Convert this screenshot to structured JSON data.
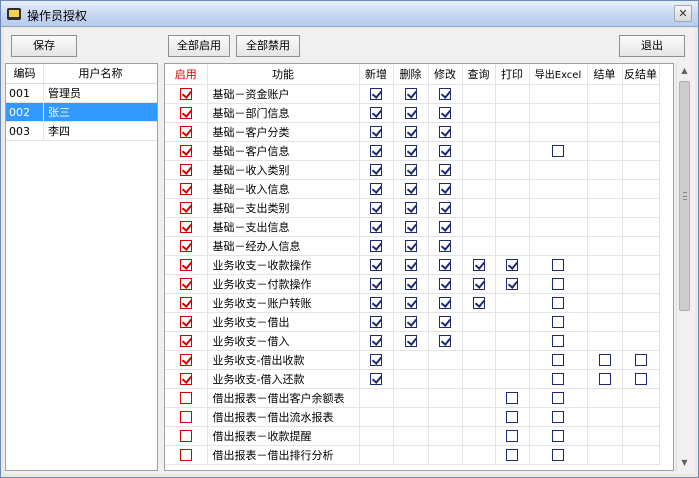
{
  "window": {
    "title": "操作员授权",
    "close_label": "✕"
  },
  "toolbar": {
    "save_label": "保存",
    "enable_all_label": "全部启用",
    "disable_all_label": "全部禁用",
    "exit_label": "退出"
  },
  "users": {
    "headers": {
      "code": "编码",
      "name": "用户名称"
    },
    "rows": [
      {
        "code": "001",
        "name": "管理员",
        "selected": false
      },
      {
        "code": "002",
        "name": "张三",
        "selected": true
      },
      {
        "code": "003",
        "name": "李四",
        "selected": false
      }
    ]
  },
  "permissions": {
    "headers": {
      "enabled": "启用",
      "function": "功能",
      "add": "新增",
      "delete": "删除",
      "edit": "修改",
      "query": "查询",
      "print": "打印",
      "export": "导出Excel",
      "close": "结单",
      "reopen": "反结单"
    },
    "rows": [
      {
        "enabled": true,
        "function": "基础－资金账户",
        "add": true,
        "delete": true,
        "edit": true,
        "query": null,
        "print": null,
        "export": null,
        "close": null,
        "reopen": null
      },
      {
        "enabled": true,
        "function": "基础－部门信息",
        "add": true,
        "delete": true,
        "edit": true,
        "query": null,
        "print": null,
        "export": null,
        "close": null,
        "reopen": null
      },
      {
        "enabled": true,
        "function": "基础－客户分类",
        "add": true,
        "delete": true,
        "edit": true,
        "query": null,
        "print": null,
        "export": null,
        "close": null,
        "reopen": null
      },
      {
        "enabled": true,
        "function": "基础－客户信息",
        "add": true,
        "delete": true,
        "edit": true,
        "query": null,
        "print": null,
        "export": false,
        "close": null,
        "reopen": null
      },
      {
        "enabled": true,
        "function": "基础－收入类别",
        "add": true,
        "delete": true,
        "edit": true,
        "query": null,
        "print": null,
        "export": null,
        "close": null,
        "reopen": null
      },
      {
        "enabled": true,
        "function": "基础－收入信息",
        "add": true,
        "delete": true,
        "edit": true,
        "query": null,
        "print": null,
        "export": null,
        "close": null,
        "reopen": null
      },
      {
        "enabled": true,
        "function": "基础－支出类别",
        "add": true,
        "delete": true,
        "edit": true,
        "query": null,
        "print": null,
        "export": null,
        "close": null,
        "reopen": null
      },
      {
        "enabled": true,
        "function": "基础－支出信息",
        "add": true,
        "delete": true,
        "edit": true,
        "query": null,
        "print": null,
        "export": null,
        "close": null,
        "reopen": null
      },
      {
        "enabled": true,
        "function": "基础－经办人信息",
        "add": true,
        "delete": true,
        "edit": true,
        "query": null,
        "print": null,
        "export": null,
        "close": null,
        "reopen": null
      },
      {
        "enabled": true,
        "function": "业务收支－收款操作",
        "add": true,
        "delete": true,
        "edit": true,
        "query": true,
        "print": true,
        "export": false,
        "close": null,
        "reopen": null
      },
      {
        "enabled": true,
        "function": "业务收支－付款操作",
        "add": true,
        "delete": true,
        "edit": true,
        "query": true,
        "print": true,
        "export": false,
        "close": null,
        "reopen": null
      },
      {
        "enabled": true,
        "function": "业务收支－账户转账",
        "add": true,
        "delete": true,
        "edit": true,
        "query": true,
        "print": null,
        "export": false,
        "close": null,
        "reopen": null
      },
      {
        "enabled": true,
        "function": "业务收支－借出",
        "add": true,
        "delete": true,
        "edit": true,
        "query": null,
        "print": null,
        "export": false,
        "close": null,
        "reopen": null
      },
      {
        "enabled": true,
        "function": "业务收支－借入",
        "add": true,
        "delete": true,
        "edit": true,
        "query": null,
        "print": null,
        "export": false,
        "close": null,
        "reopen": null
      },
      {
        "enabled": true,
        "function": "业务收支-借出收款",
        "add": true,
        "delete": null,
        "edit": null,
        "query": null,
        "print": null,
        "export": false,
        "close": false,
        "reopen": false
      },
      {
        "enabled": true,
        "function": "业务收支-借入还款",
        "add": true,
        "delete": null,
        "edit": null,
        "query": null,
        "print": null,
        "export": false,
        "close": false,
        "reopen": false
      },
      {
        "enabled": false,
        "function": "借出报表－借出客户余额表",
        "add": null,
        "delete": null,
        "edit": null,
        "query": null,
        "print": false,
        "export": false,
        "close": null,
        "reopen": null
      },
      {
        "enabled": false,
        "function": "借出报表－借出流水报表",
        "add": null,
        "delete": null,
        "edit": null,
        "query": null,
        "print": false,
        "export": false,
        "close": null,
        "reopen": null
      },
      {
        "enabled": false,
        "function": "借出报表－收款提醒",
        "add": null,
        "delete": null,
        "edit": null,
        "query": null,
        "print": false,
        "export": false,
        "close": null,
        "reopen": null
      },
      {
        "enabled": false,
        "function": "借出报表－借出排行分析",
        "add": null,
        "delete": null,
        "edit": null,
        "query": null,
        "print": false,
        "export": false,
        "close": null,
        "reopen": null
      }
    ]
  },
  "scrollbar": {
    "up_label": "▲",
    "down_label": "▼"
  }
}
